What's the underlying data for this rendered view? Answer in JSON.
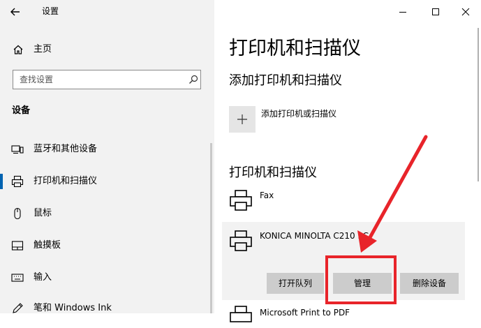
{
  "window": {
    "title": "设置",
    "controls": [
      "minimize-icon",
      "maximize-icon",
      "close-icon"
    ]
  },
  "sidebar": {
    "home_label": "主页",
    "search_placeholder": "查找设置",
    "section_heading": "设备",
    "items": [
      {
        "label": "蓝牙和其他设备",
        "icon": "bluetooth-devices-icon"
      },
      {
        "label": "打印机和扫描仪",
        "icon": "printer-icon",
        "active": true
      },
      {
        "label": "鼠标",
        "icon": "mouse-icon"
      },
      {
        "label": "触摸板",
        "icon": "touchpad-icon"
      },
      {
        "label": "输入",
        "icon": "keyboard-icon"
      },
      {
        "label": "笔和 Windows Ink",
        "icon": "pen-icon"
      }
    ]
  },
  "main": {
    "title": "打印机和扫描仪",
    "add_section_title": "添加打印机和扫描仪",
    "add_label": "添加打印机或扫描仪",
    "printers_section_title": "打印机和扫描仪",
    "printers": [
      {
        "name": "Fax"
      },
      {
        "name": "KONICA MINOLTA C210 PC",
        "selected": true
      },
      {
        "name": "Microsoft Print to PDF"
      }
    ],
    "actions": {
      "open_queue": "打开队列",
      "manage": "管理",
      "remove_device": "删除设备"
    }
  },
  "colors": {
    "accent": "#0063b1",
    "annotation": "#e8242a",
    "sidebar_bg": "#f2f2f2",
    "button_bg": "#cccccc"
  }
}
